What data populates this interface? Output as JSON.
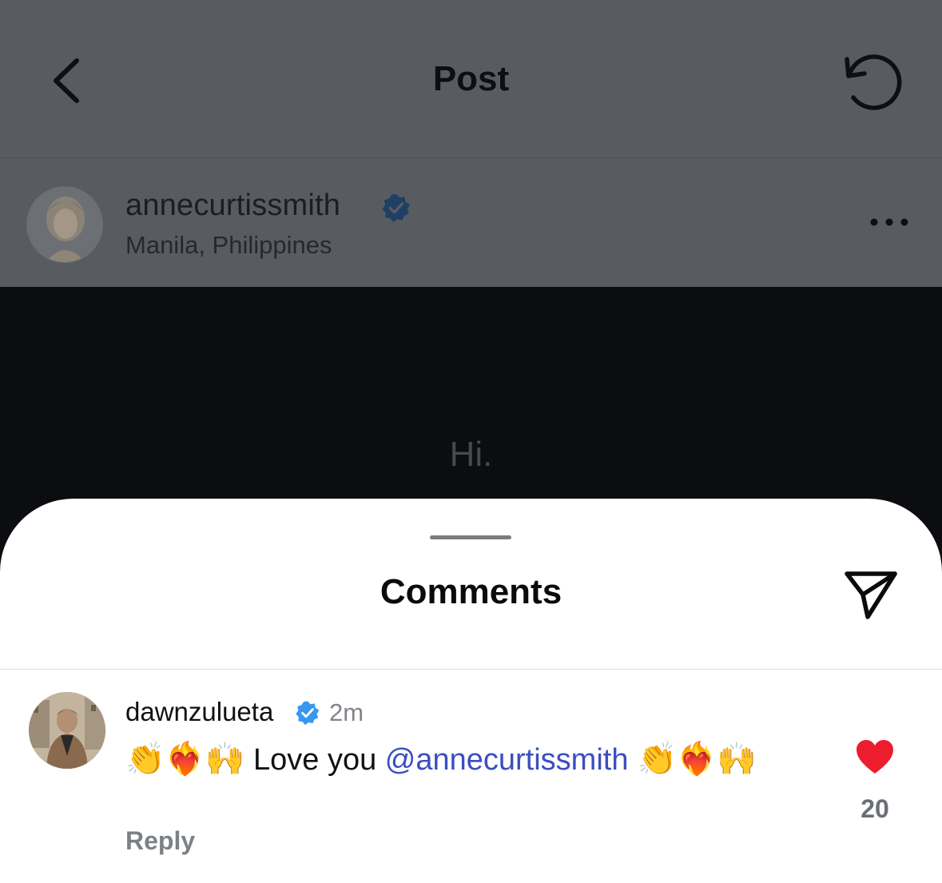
{
  "header": {
    "title": "Post",
    "back_icon": "chevron-left-icon",
    "refresh_icon": "refresh-icon"
  },
  "post": {
    "author": {
      "username": "annecurtissmith",
      "verified": true,
      "location": "Manila, Philippines"
    },
    "text_line1": "Hi.",
    "more_icon": "more-horizontal-icon"
  },
  "comments_sheet": {
    "title": "Comments",
    "share_icon": "send-icon",
    "comment": {
      "username": "dawnzulueta",
      "verified": true,
      "time": "2m",
      "emoji_before": "👏❤️‍🔥🙌",
      "text": " Love you ",
      "mention": "@annecurtissmith",
      "emoji_after": " 👏❤️‍🔥🙌",
      "reply_label": "Reply",
      "like_count": "20",
      "liked": true
    }
  },
  "colors": {
    "overlay_gray": "#585c60",
    "like_red": "#ee1d2d",
    "verified_blue": "#3897f0",
    "mention_blue": "#3a4ec2"
  }
}
